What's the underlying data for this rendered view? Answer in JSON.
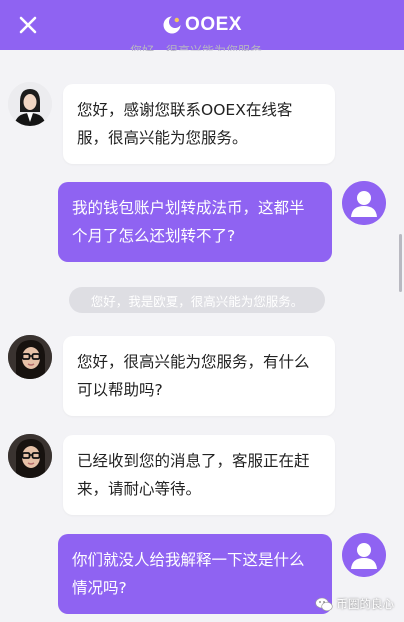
{
  "header": {
    "brand_name": "OOEX",
    "close_icon": "close-icon",
    "background_color": "#8f63f2"
  },
  "peek_text": "您好，很高兴能为您服务。",
  "messages": [
    {
      "side": "left",
      "avatar": "agent-avatar-formal",
      "text": "您好，感谢您联系OOEX在线客服，很高兴能为您服务。"
    },
    {
      "side": "right",
      "avatar": "user-avatar",
      "text": "我的钱包账户划转成法币，这都半个月了怎么还划转不了?"
    },
    {
      "side": "left",
      "avatar": "agent-avatar-glasses",
      "text": "您好，很高兴能为您服务，有什么可以帮助吗?"
    },
    {
      "side": "left",
      "avatar": "agent-avatar-glasses",
      "text": "已经收到您的消息了，客服正在赶来，请耐心等待。"
    },
    {
      "side": "right",
      "avatar": "user-avatar",
      "text": "你们就没人给我解释一下这是什么情况吗?"
    }
  ],
  "system_message": "您好，我是欧夏，很高兴能为您服务。",
  "watermark": {
    "text": "币圈的良心",
    "icon": "wechat-icon"
  },
  "colors": {
    "accent": "#8f63f2",
    "page_bg": "#f3f3f6",
    "bubble_left": "#ffffff",
    "pill_bg": "#dedee3"
  }
}
